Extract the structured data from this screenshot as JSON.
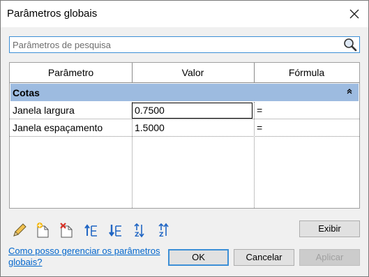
{
  "window": {
    "title": "Parâmetros globais"
  },
  "search": {
    "placeholder": "Parâmetros de pesquisa"
  },
  "grid": {
    "columns": [
      "Parâmetro",
      "Valor",
      "Fórmula"
    ],
    "group": {
      "label": "Cotas",
      "collapse_icon": "double-chevron-up-icon"
    },
    "rows": [
      {
        "parameter": "Janela largura",
        "value": "0.7500",
        "formula": "="
      },
      {
        "parameter": "Janela espaçamento",
        "value": "1.5000",
        "formula": "="
      }
    ]
  },
  "toolbar": {
    "icons": [
      "edit-pencil-icon",
      "new-parameter-icon",
      "delete-parameter-icon",
      "move-up-icon",
      "move-down-icon",
      "sort-ascending-icon",
      "sort-descending-icon"
    ]
  },
  "buttons": {
    "show": "Exibir",
    "ok": "OK",
    "cancel": "Cancelar",
    "apply": "Aplicar"
  },
  "help": {
    "link": "Como posso gerenciar os parâmetros globais?"
  },
  "colors": {
    "group_header": "#9dbbe0",
    "accent": "#3c8fd6",
    "link": "#0066cc"
  }
}
